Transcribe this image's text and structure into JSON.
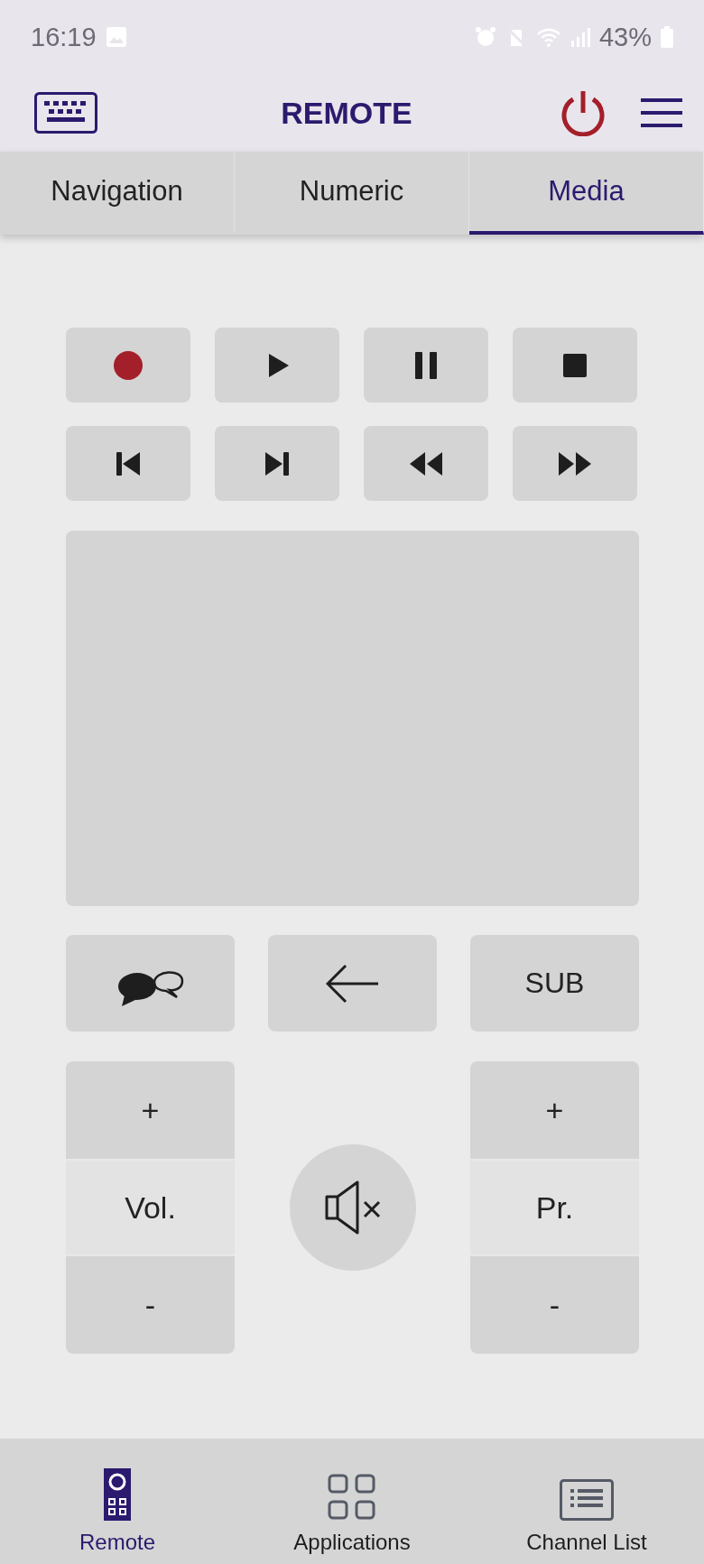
{
  "status_bar": {
    "time": "16:19",
    "battery": "43%"
  },
  "header": {
    "title": "REMOTE"
  },
  "tabs": [
    {
      "label": "Navigation",
      "selected": false
    },
    {
      "label": "Numeric",
      "selected": false
    },
    {
      "label": "Media",
      "selected": true
    }
  ],
  "media_buttons": [
    {
      "kind": "record"
    },
    {
      "kind": "play"
    },
    {
      "kind": "pause"
    },
    {
      "kind": "stop"
    },
    {
      "kind": "previous"
    },
    {
      "kind": "next"
    },
    {
      "kind": "rewind"
    },
    {
      "kind": "forward"
    }
  ],
  "action_buttons": [
    {
      "kind": "chat"
    },
    {
      "kind": "back"
    },
    {
      "kind": "text",
      "label": "SUB"
    }
  ],
  "rockers": [
    {
      "plus": "+",
      "label": "Vol.",
      "minus": "-"
    },
    {
      "plus": "+",
      "label": "Pr.",
      "minus": "-"
    }
  ],
  "bottom_nav": [
    {
      "label": "Remote",
      "kind": "remote",
      "selected": true
    },
    {
      "label": "Applications",
      "kind": "apps",
      "selected": false
    },
    {
      "label": "Channel List",
      "kind": "list",
      "selected": false
    }
  ]
}
